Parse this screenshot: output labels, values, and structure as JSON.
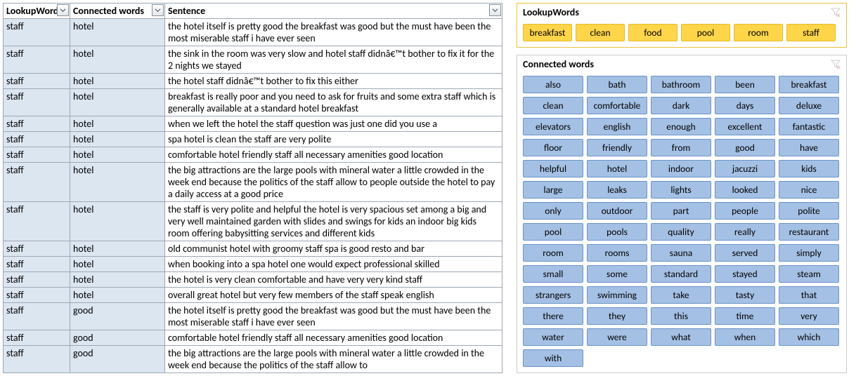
{
  "table": {
    "headers": {
      "lookup": "LookupWords",
      "connected": "Connected words",
      "sentence": "Sentence"
    },
    "rows": [
      {
        "lookup": "staff",
        "connected": "hotel",
        "sentence": "the hotel itself is pretty good  the breakfast was good  but the must have been the most miserable staff i have ever seen"
      },
      {
        "lookup": "staff",
        "connected": "hotel",
        "sentence": "the sink in the room was very slow and hotel staff didnâ€™t bother to fix it for the 2 nights we stayed"
      },
      {
        "lookup": "staff",
        "connected": "hotel",
        "sentence": " the hotel staff didnâ€™t bother to fix this either"
      },
      {
        "lookup": "staff",
        "connected": "hotel",
        "sentence": " breakfast is really poor and you need to ask for fruits and some extra staff which is generally available at a standard hotel breakfast"
      },
      {
        "lookup": "staff",
        "connected": "hotel",
        "sentence": " when we left the hotel  the staff question was just one   did you use a"
      },
      {
        "lookup": "staff",
        "connected": "hotel",
        "sentence": "spa hotel  is clean  the staff are very polite"
      },
      {
        "lookup": "staff",
        "connected": "hotel",
        "sentence": "comfortable hotel  friendly staff  all necessary amenities  good location"
      },
      {
        "lookup": "staff",
        "connected": "hotel",
        "sentence": " the big attractions are the large pools with mineral water  a little crowded in the week end  because the politics of the staff allow to people outside the hotel to pay a daily access at a good price"
      },
      {
        "lookup": "staff",
        "connected": "hotel",
        "sentence": " the staff is very polite and helpful  the hotel is very spacious  set among a big and very well maintained garden with slides and swings for kids  an indoor big kids room  offering babysitting services and different kids"
      },
      {
        "lookup": "staff",
        "connected": "hotel",
        "sentence": " old communist hotel with groomy staff spa is good  resto and bar"
      },
      {
        "lookup": "staff",
        "connected": "hotel",
        "sentence": "when booking into a spa hotel  one would expect professional skilled"
      },
      {
        "lookup": "staff",
        "connected": "hotel",
        "sentence": "the hotel is very clean  comfortable  and have very very kind staff"
      },
      {
        "lookup": "staff",
        "connected": "hotel",
        "sentence": " overall   great hotel but very few members of the staff speak english"
      },
      {
        "lookup": "staff",
        "connected": "good",
        "sentence": "the hotel itself is pretty good  the breakfast was good  but the must have been the most miserable staff i have ever seen"
      },
      {
        "lookup": "staff",
        "connected": "good",
        "sentence": " comfortable hotel  friendly staff  all necessary amenities  good location"
      },
      {
        "lookup": "staff",
        "connected": "good",
        "sentence": " the big attractions are the large pools with mineral water  a little crowded in the week end  because the politics of the staff allow to"
      }
    ]
  },
  "slicers": {
    "lookup": {
      "title": "LookupWords",
      "items": [
        "breakfast",
        "clean",
        "food",
        "pool",
        "room",
        "staff"
      ]
    },
    "connected": {
      "title": "Connected words",
      "items": [
        "also",
        "bath",
        "bathroom",
        "been",
        "breakfast",
        "clean",
        "comfortable",
        "dark",
        "days",
        "deluxe",
        "elevators",
        "english",
        "enough",
        "excellent",
        "fantastic",
        "floor",
        "friendly",
        "from",
        "good",
        "have",
        "helpful",
        "hotel",
        "indoor",
        "jacuzzi",
        "kids",
        "large",
        "leaks",
        "lights",
        "looked",
        "nice",
        "only",
        "outdoor",
        "part",
        "people",
        "polite",
        "pool",
        "pools",
        "quality",
        "really",
        "restaurant",
        "room",
        "rooms",
        "sauna",
        "served",
        "simply",
        "small",
        "some",
        "standard",
        "stayed",
        "steam",
        "strangers",
        "swimming",
        "take",
        "tasty",
        "that",
        "there",
        "they",
        "this",
        "time",
        "very",
        "water",
        "were",
        "what",
        "when",
        "which",
        "with"
      ]
    }
  }
}
